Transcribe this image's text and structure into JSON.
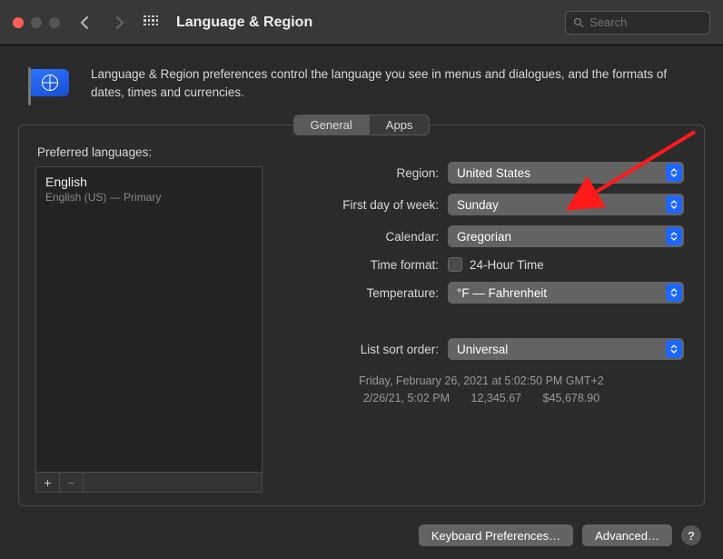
{
  "titlebar": {
    "title": "Language & Region",
    "search_placeholder": "Search"
  },
  "description": "Language & Region preferences control the language you see in menus and dialogues, and the formats of dates, times and currencies.",
  "tabs": {
    "general": "General",
    "apps": "Apps"
  },
  "left": {
    "header": "Preferred languages:",
    "lang_name": "English",
    "lang_sub": "English (US) — Primary",
    "plus": "+",
    "minus": "−"
  },
  "form": {
    "region_label": "Region:",
    "region_value": "United States",
    "firstday_label": "First day of week:",
    "firstday_value": "Sunday",
    "calendar_label": "Calendar:",
    "calendar_value": "Gregorian",
    "timeformat_label": "Time format:",
    "timeformat_value": "24-Hour Time",
    "temperature_label": "Temperature:",
    "temperature_value": "°F — Fahrenheit",
    "listsort_label": "List sort order:",
    "listsort_value": "Universal"
  },
  "sample": {
    "line1": "Friday, February 26, 2021 at 5:02:50 PM GMT+2",
    "date2": "2/26/21, 5:02 PM",
    "num": "12,345.67",
    "currency": "$45,678.90"
  },
  "buttons": {
    "keyboard": "Keyboard Preferences…",
    "advanced": "Advanced…",
    "help": "?"
  }
}
